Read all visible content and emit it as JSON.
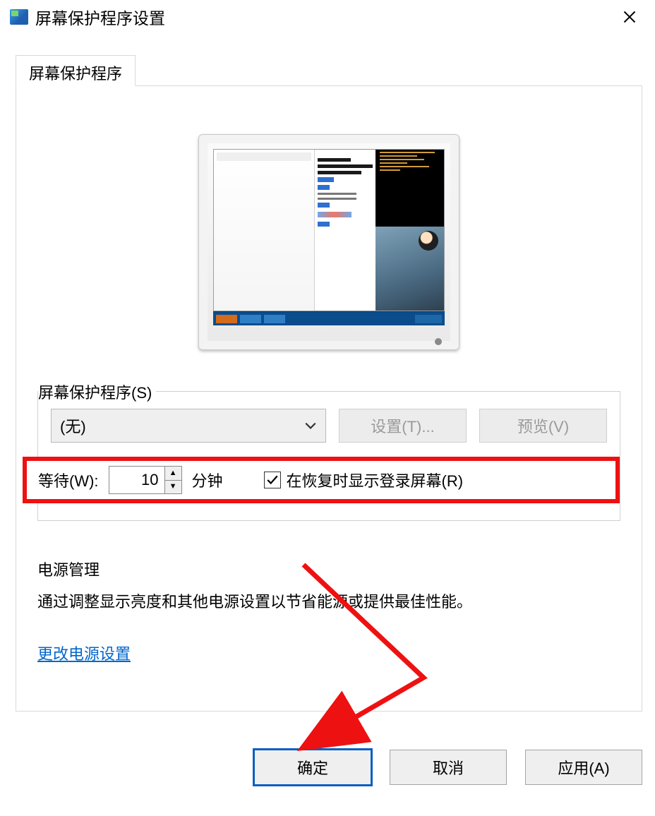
{
  "window": {
    "title": "屏幕保护程序设置"
  },
  "tab": {
    "label": "屏幕保护程序"
  },
  "screensaver": {
    "group_label": "屏幕保护程序(S)",
    "combo_value": "(无)",
    "settings_btn": "设置(T)...",
    "preview_btn": "预览(V)"
  },
  "wait": {
    "label": "等待(W):",
    "value": "10",
    "unit": "分钟",
    "checkbox_label": "在恢复时显示登录屏幕(R)"
  },
  "power": {
    "heading": "电源管理",
    "desc": "通过调整显示亮度和其他电源设置以节省能源或提供最佳性能。",
    "link": "更改电源设置"
  },
  "buttons": {
    "ok": "确定",
    "cancel": "取消",
    "apply": "应用(A)"
  }
}
